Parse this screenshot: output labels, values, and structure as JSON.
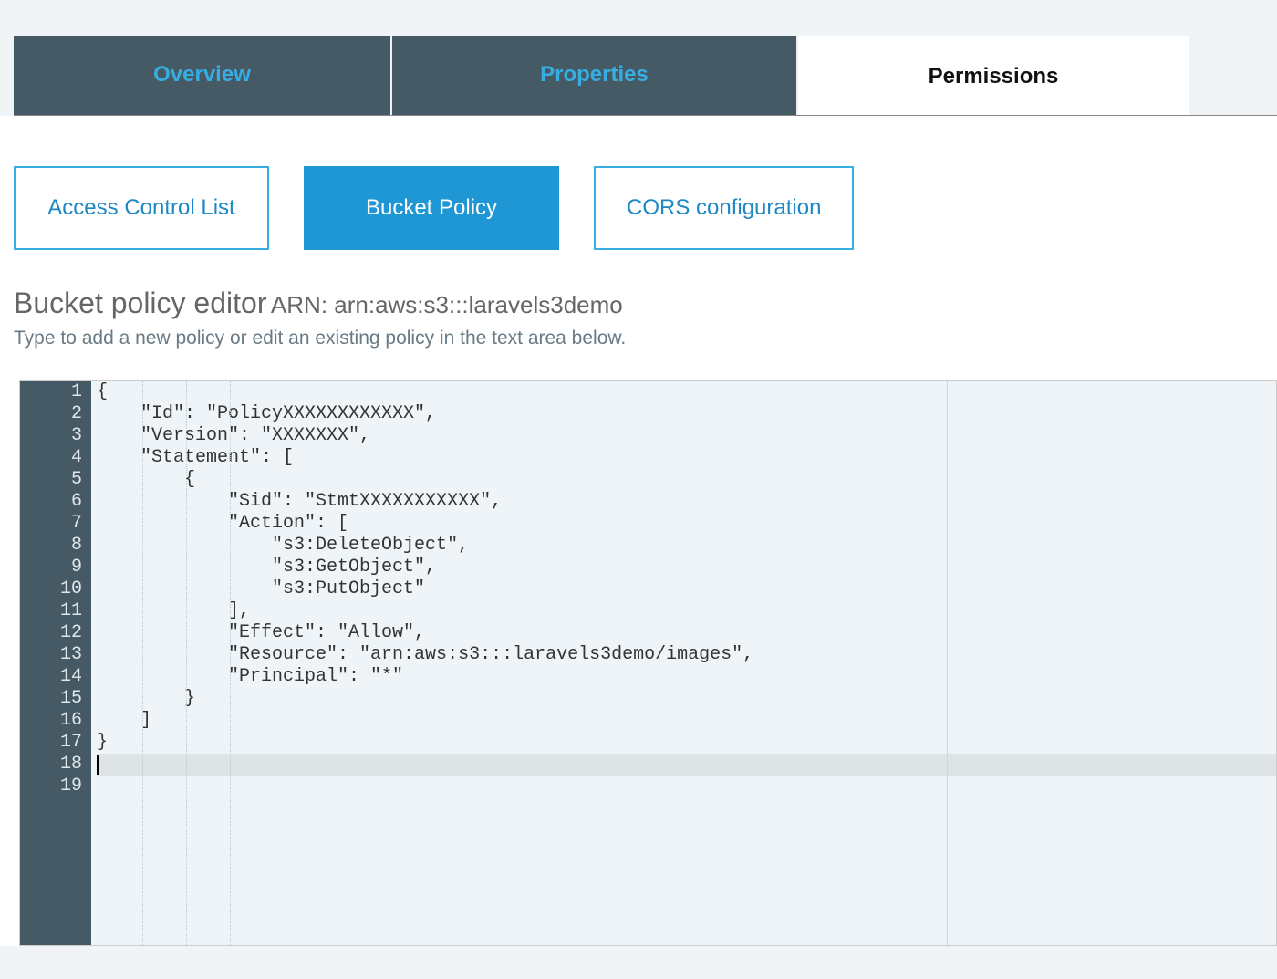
{
  "tabs": {
    "overview": "Overview",
    "properties": "Properties",
    "permissions": "Permissions"
  },
  "subtabs": {
    "acl": "Access Control List",
    "bucket_policy": "Bucket Policy",
    "cors": "CORS configuration"
  },
  "editor": {
    "title": "Bucket policy editor",
    "arn_label": "ARN: ",
    "arn_value": "arn:aws:s3:::laravels3demo",
    "description": "Type to add a new policy or edit an existing policy in the text area below.",
    "line_count": 19,
    "active_line": 18,
    "code_lines": [
      "{",
      "    \"Id\": \"PolicyXXXXXXXXXXXX\",",
      "    \"Version\": \"XXXXXXX\",",
      "    \"Statement\": [",
      "        {",
      "            \"Sid\": \"StmtXXXXXXXXXXX\",",
      "            \"Action\": [",
      "                \"s3:DeleteObject\",",
      "                \"s3:GetObject\",",
      "                \"s3:PutObject\"",
      "            ],",
      "            \"Effect\": \"Allow\",",
      "            \"Resource\": \"arn:aws:s3:::laravels3demo/images\",",
      "            \"Principal\": \"*\"",
      "        }",
      "    ]",
      "}",
      "",
      ""
    ]
  }
}
